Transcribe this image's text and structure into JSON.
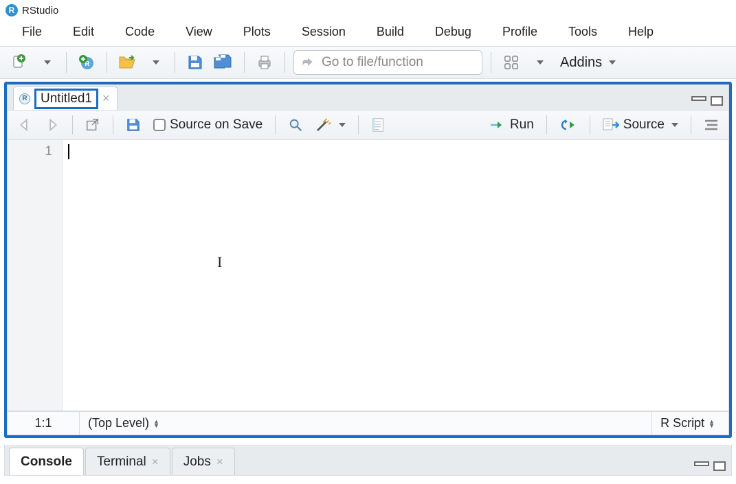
{
  "app": {
    "title": "RStudio"
  },
  "menu": [
    "File",
    "Edit",
    "Code",
    "View",
    "Plots",
    "Session",
    "Build",
    "Debug",
    "Profile",
    "Tools",
    "Help"
  ],
  "mainToolbar": {
    "searchPlaceholder": "Go to file/function",
    "addins": "Addins"
  },
  "editor": {
    "tab": {
      "name": "Untitled1"
    },
    "toolbar": {
      "sourceOnSave": "Source on Save",
      "run": "Run",
      "source": "Source"
    },
    "gutter": [
      "1"
    ],
    "status": {
      "pos": "1:1",
      "scope": "(Top Level)",
      "type": "R Script"
    }
  },
  "bottomTabs": {
    "console": "Console",
    "terminal": "Terminal",
    "jobs": "Jobs"
  }
}
